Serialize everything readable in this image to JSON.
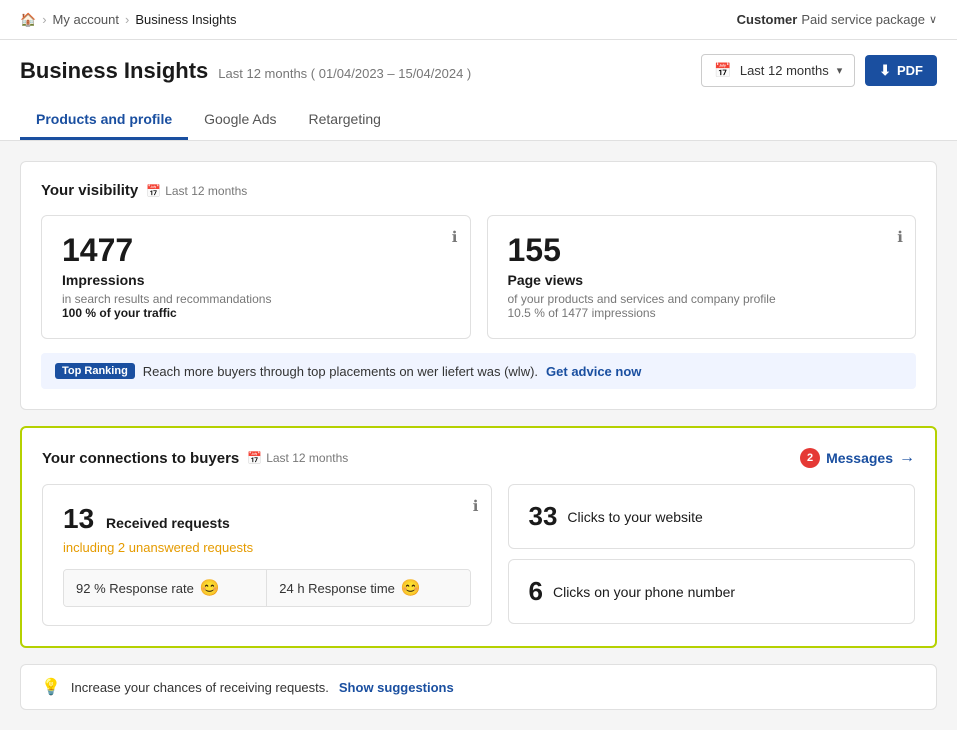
{
  "topbar": {
    "home_icon": "🏠",
    "breadcrumb": {
      "home": "",
      "separator1": ">",
      "account": "My account",
      "separator2": ">",
      "current": "Business Insights"
    },
    "customer_label": "Customer",
    "package_label": "Paid service package",
    "chevron": "∨"
  },
  "header": {
    "title": "Business Insights",
    "date_range": "Last 12 months ( 01/04/2023 – 15/04/2024 )",
    "date_picker_label": "Last 12 months",
    "pdf_label": "PDF"
  },
  "tabs": [
    {
      "id": "products",
      "label": "Products and profile",
      "active": true
    },
    {
      "id": "google_ads",
      "label": "Google Ads",
      "active": false
    },
    {
      "id": "retargeting",
      "label": "Retargeting",
      "active": false
    }
  ],
  "visibility": {
    "section_title": "Your visibility",
    "period_label": "Last 12 months",
    "impressions": {
      "number": "1477",
      "label": "Impressions",
      "sublabel1": "in search results and recommandations",
      "sublabel2": "100 % of your traffic"
    },
    "pageviews": {
      "number": "155",
      "label": "Page views",
      "sublabel1": "of your products and services and company profile",
      "sublabel2": "10.5 % of 1477 impressions"
    },
    "banner": {
      "badge": "Top Ranking",
      "text": "Reach more buyers through top placements on  wer liefert was (wlw).",
      "link_text": "Get advice now"
    }
  },
  "connections": {
    "section_title": "Your connections to buyers",
    "period_label": "Last 12 months",
    "messages_count": "2",
    "messages_label": "Messages",
    "requests": {
      "number": "13",
      "label": "Received requests",
      "unanswered_text": "including 2 unanswered requests",
      "response_rate": "92 % Response rate",
      "response_time": "24 h Response time"
    },
    "clicks_website": {
      "number": "33",
      "label": "Clicks to your website"
    },
    "clicks_phone": {
      "number": "6",
      "label": "Clicks on your phone number"
    }
  },
  "suggestions": {
    "icon": "💡",
    "text": "Increase your chances of receiving requests.",
    "link_text": "Show suggestions"
  }
}
